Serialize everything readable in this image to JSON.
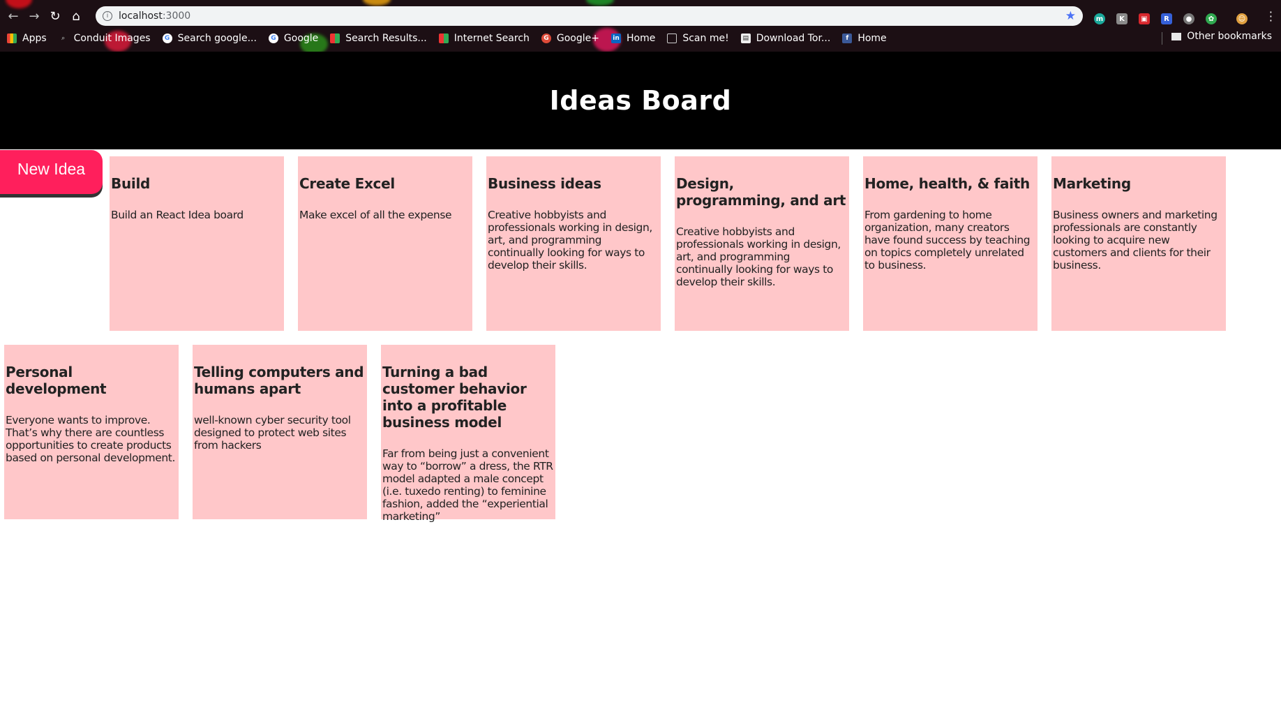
{
  "browser": {
    "url_host": "localhost",
    "url_port": ":3000",
    "bookmarks": [
      {
        "label": "Apps"
      },
      {
        "label": "Conduit Images"
      },
      {
        "label": "Search google..."
      },
      {
        "label": "Google"
      },
      {
        "label": "Search Results..."
      },
      {
        "label": "Internet Search"
      },
      {
        "label": "Google+"
      },
      {
        "label": "Home"
      },
      {
        "label": "Scan me!"
      },
      {
        "label": "Download Tor..."
      },
      {
        "label": "Home"
      }
    ],
    "other_bookmarks": "Other bookmarks"
  },
  "app": {
    "title": "Ideas Board",
    "new_idea_label": "New Idea"
  },
  "ideas": [
    {
      "title": "Build",
      "body": "Build an React Idea board"
    },
    {
      "title": "Create Excel",
      "body": "Make excel of all the expense"
    },
    {
      "title": "Business ideas",
      "body": "Creative hobbyists and professionals working in design, art, and programming continually looking for ways to develop their skills."
    },
    {
      "title": "Design, programming, and art",
      "body": "Creative hobbyists and professionals working in design, art, and programming continually looking for ways to develop their skills."
    },
    {
      "title": "Home, health, & faith",
      "body": "From gardening to home organization, many creators have found success by teaching on topics completely unrelated to business."
    },
    {
      "title": "Marketing",
      "body": "Business owners and marketing professionals are constantly looking to acquire new customers and clients for their business."
    },
    {
      "title": "Personal development",
      "body": "Everyone wants to improve. That’s why there are countless opportunities to create products based on personal development."
    },
    {
      "title": "Telling computers and humans apart",
      "body": "well-known cyber security tool designed to protect web sites from hackers"
    },
    {
      "title": "Turning a bad customer behavior into a profitable business model",
      "body": "Far from being just a convenient way to “borrow” a dress, the RTR model adapted a male concept (i.e. tuxedo renting) to feminine fashion, added the “experiential marketing”"
    }
  ]
}
